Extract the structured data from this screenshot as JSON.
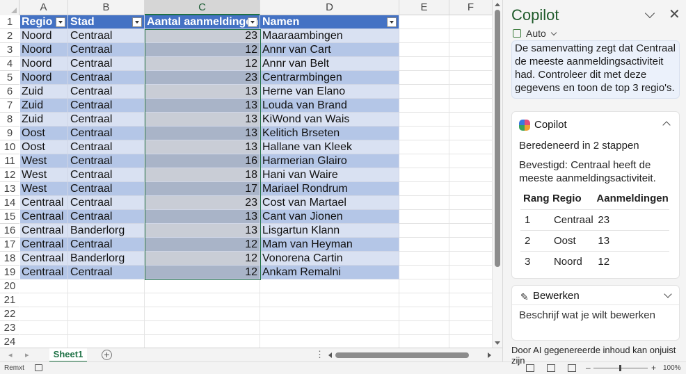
{
  "sheet": {
    "columns": [
      "A",
      "B",
      "C",
      "D",
      "E",
      "F"
    ],
    "row_numbers": [
      "1",
      "2",
      "3",
      "4",
      "5",
      "6",
      "7",
      "8",
      "9",
      "10",
      "11",
      "12",
      "13",
      "14",
      "15",
      "16",
      "17",
      "18",
      "19",
      "20",
      "21",
      "22",
      "23",
      "24"
    ],
    "table_headers": [
      "Regio",
      "Stad",
      "Aantal aanmeldingen",
      "Namen"
    ],
    "rows": [
      [
        "Noord",
        "Centraal",
        "23",
        "Maaraambingen"
      ],
      [
        "Noord",
        "Centraal",
        "12",
        "Annr van Cart"
      ],
      [
        "Noord",
        "Centraal",
        "12",
        "Annr van Belt"
      ],
      [
        "Noord",
        "Centraal",
        "23",
        "Centrarmbingen"
      ],
      [
        "Zuid",
        "Centraal",
        "13",
        "Herne van Elano"
      ],
      [
        "Zuid",
        "Centraal",
        "13",
        "Louda van Brand"
      ],
      [
        "Zuid",
        "Centraal",
        "13",
        "KiWond van Wais"
      ],
      [
        "Oost",
        "Centraal",
        "13",
        "Kelitich Brseten"
      ],
      [
        "Oost",
        "Centraal",
        "13",
        "Hallane van Kleek"
      ],
      [
        "West",
        "Centraal",
        "16",
        "Harmerian Glairo"
      ],
      [
        "West",
        "Centraal",
        "18",
        "Hani van Waire"
      ],
      [
        "West",
        "Centraal",
        "17",
        "Mariael Rondrum"
      ],
      [
        "Centraal",
        "Centraal",
        "23",
        "Cost van Martael"
      ],
      [
        "Centraal",
        "Centraal",
        "13",
        "Cant van Jionen"
      ],
      [
        "Centraal",
        "Banderlorg",
        "13",
        "Lisgartun Klann"
      ],
      [
        "Centraal",
        "Centraal",
        "12",
        "Mam van Heyman"
      ],
      [
        "Centraal",
        "Banderlorg",
        "12",
        "Vonorena Cartin"
      ],
      [
        "Centraal",
        "Centraal",
        "12",
        "Ankam Remalni"
      ]
    ],
    "selected_column": "C",
    "tab_name": "Sheet1",
    "tab_overflow": "⋮"
  },
  "status": {
    "mode": "Remxt",
    "zoom": "100%"
  },
  "copilot": {
    "title": "Copilot",
    "mode_label": "Auto",
    "prompt": "De samenvatting zegt dat Centraal de meeste aanmeldingsactiviteit had. Controleer dit met deze gegevens en toon de top 3 regio's.",
    "response_title": "Copilot",
    "steps": "Beredeneerd in 2 stappen",
    "confirmation": "Bevestigd: Centraal heeft de meeste aanmeldingsactiviteit.",
    "table_headers": [
      "Rang",
      "Regio",
      "Aanmeldingen"
    ],
    "table_rows": [
      [
        "1",
        "Centraal",
        "23"
      ],
      [
        "2",
        "Oost",
        "13"
      ],
      [
        "3",
        "Noord",
        "12"
      ]
    ],
    "edit_title": "Bewerken",
    "edit_placeholder": "Beschrijf wat je wilt bewerken",
    "disclaimer": "Door AI gegenereerde inhoud kan onjuist zijn"
  }
}
